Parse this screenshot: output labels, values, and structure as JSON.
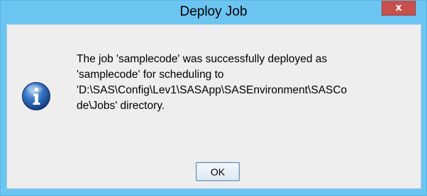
{
  "window": {
    "title": "Deploy Job",
    "close_label": "x",
    "colors": {
      "frame": "#6cc4f1",
      "close_button": "#c7504c",
      "content": "#eeeeee"
    }
  },
  "dialog": {
    "icon": "info-icon",
    "message": "The job 'samplecode' was successfully deployed as\n'samplecode' for scheduling to\n'D:\\SAS\\Config\\Lev1\\SASApp\\SASEnvironment\\SASCo\nde\\Jobs' directory.",
    "ok_label": "OK"
  }
}
